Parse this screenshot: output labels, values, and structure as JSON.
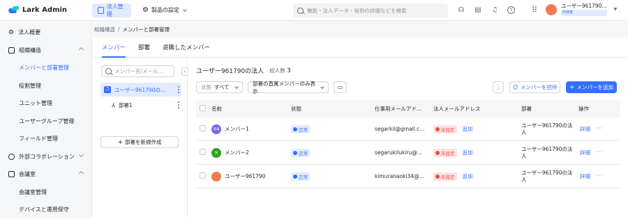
{
  "app": {
    "name": "Lark Admin"
  },
  "topnav": {
    "tab_org": "法人管理",
    "tab_settings": "製品の設定",
    "search_placeholder": "機能・法人データ・役割の詳細などを検索",
    "user_name": "ユーザー961790...",
    "user_badge": "作成者"
  },
  "sidebar": {
    "items": [
      {
        "label": "法人概要"
      },
      {
        "label": "組織構造"
      },
      {
        "label": "メンバーと部署管理"
      },
      {
        "label": "役割管理"
      },
      {
        "label": "ユニット管理"
      },
      {
        "label": "ユーザーグループ管理"
      },
      {
        "label": "フィールド管理"
      },
      {
        "label": "外部コラボレーション"
      },
      {
        "label": "会議室"
      },
      {
        "label": "会議室管理"
      },
      {
        "label": "デバイスと運用保守"
      }
    ]
  },
  "breadcrumb": {
    "parent": "組織構造",
    "sep": "/",
    "current": "メンバーと部署管理"
  },
  "tabs": [
    {
      "label": "メンバー"
    },
    {
      "label": "部署"
    },
    {
      "label": "退職したメンバー"
    }
  ],
  "tree": {
    "search_placeholder": "メンバー名/メール...",
    "root": {
      "label": "ユーザー961790の...",
      "icon_text": "ユ"
    },
    "child": {
      "label": "部署1"
    },
    "new_button": "部署を新規作成"
  },
  "content": {
    "title": "ユーザー961790の法人",
    "count_label": "総人数",
    "count": "3",
    "filter_status_label": "状態",
    "filter_status_value": "すべて",
    "filter_direct": "部署の直属メンバーのみ表示",
    "invite_button": "メンバーを招待",
    "add_button": "メンバーを追加"
  },
  "table": {
    "headers": [
      "名前",
      "状態",
      "仕事用メールアド...",
      "法人メールアドレス",
      "部署",
      "操作"
    ],
    "rows": [
      {
        "name": "メンバー1",
        "avatar_text": "目录",
        "avatar_color": "#7b67ee",
        "status": "正常",
        "email": "segarkil@gmail.c...",
        "corp_status": "未設定",
        "corp_action": "追加",
        "dept1": "ユーザー961790の法",
        "dept2": "人",
        "action": "詳細"
      },
      {
        "name": "メンバー2",
        "avatar_text": "✕",
        "avatar_color": "#2ea121",
        "status": "正常",
        "email": "segarukilukiru@...",
        "corp_status": "未設定",
        "corp_action": "追加",
        "dept1": "ユーザー961790の法",
        "dept2": "人",
        "action": "詳細"
      },
      {
        "name": "ユーザー961790",
        "avatar_text": "",
        "avatar_color": "#f07b4f",
        "status": "正常",
        "email": "kimuranaoki34@...",
        "corp_status": "未設定",
        "corp_action": "追加",
        "dept1": "ユーザー961790の法",
        "dept2": "人",
        "action": "詳細"
      }
    ]
  },
  "colors": {
    "accent": "#3370ff",
    "danger": "#f54a45"
  }
}
